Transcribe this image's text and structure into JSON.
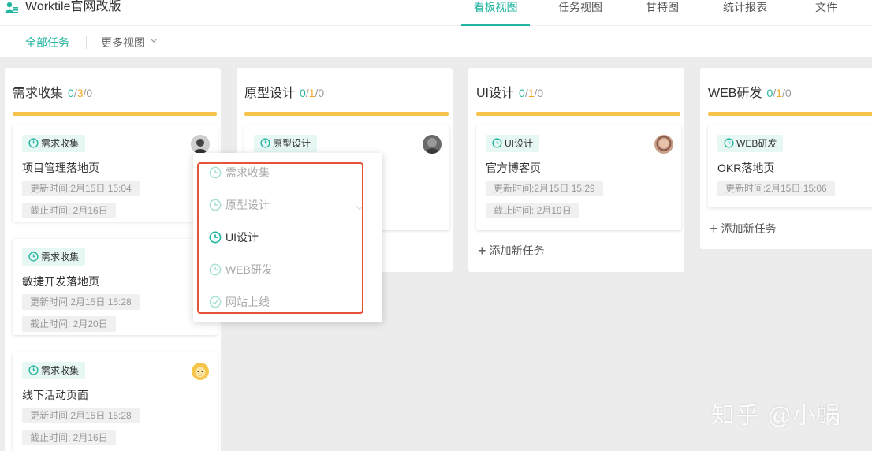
{
  "app": {
    "title": "Worktile官网改版"
  },
  "topnav": {
    "tabs": [
      {
        "label": "看板视图",
        "active": true
      },
      {
        "label": "任务视图",
        "active": false
      },
      {
        "label": "甘特图",
        "active": false
      },
      {
        "label": "统计报表",
        "active": false
      },
      {
        "label": "文件",
        "active": false
      }
    ]
  },
  "subbar": {
    "all_tasks": "全部任务",
    "more_views": "更多视图"
  },
  "columns": [
    {
      "title": "需求收集",
      "count": {
        "a": "0",
        "b": "3",
        "c": "0"
      },
      "cards": [
        {
          "tag": "需求收集",
          "title": "项目管理落地页",
          "updated": "更新时间:2月15日 15:04",
          "deadline": "截止时间: 2月16日"
        },
        {
          "tag": "需求收集",
          "title": "敏捷开发落地页",
          "updated": "更新时间:2月15日 15:28",
          "deadline": "截止时间: 2月20日"
        },
        {
          "tag": "需求收集",
          "title": "线下活动页面",
          "updated": "更新时间:2月15日 15:28",
          "deadline": "截止时间: 2月16日"
        }
      ]
    },
    {
      "title": "原型设计",
      "count": {
        "a": "0",
        "b": "1",
        "c": "0"
      },
      "cards": [
        {
          "tag": "原型设计"
        }
      ]
    },
    {
      "title": "UI设计",
      "count": {
        "a": "0",
        "b": "1",
        "c": "0"
      },
      "cards": [
        {
          "tag": "UI设计",
          "title": "官方博客页",
          "updated": "更新时间:2月15日 15:29",
          "deadline": "截止时间: 2月19日"
        }
      ],
      "add_task": "添加新任务"
    },
    {
      "title": "WEB研发",
      "count": {
        "a": "0",
        "b": "1",
        "c": "0"
      },
      "cards": [
        {
          "tag": "WEB研发",
          "title": "OKR落地页",
          "updated": "更新时间:2月15日 15:06"
        }
      ],
      "add_task": "添加新任务"
    }
  ],
  "dropdown": {
    "items": [
      {
        "label": "需求收集",
        "icon": "clock-icon"
      },
      {
        "label": "原型设计",
        "icon": "clock-icon"
      },
      {
        "label": "UI设计",
        "icon": "clock-icon",
        "current": true
      },
      {
        "label": "WEB研发",
        "icon": "clock-icon"
      },
      {
        "label": "网站上线",
        "icon": "check-circle-icon"
      }
    ]
  },
  "watermark": "知乎 @小蜗",
  "colors": {
    "accent": "#22b59f",
    "progress": "#f7c34c",
    "count_orange": "#f5a623",
    "highlight": "#e5543a"
  }
}
